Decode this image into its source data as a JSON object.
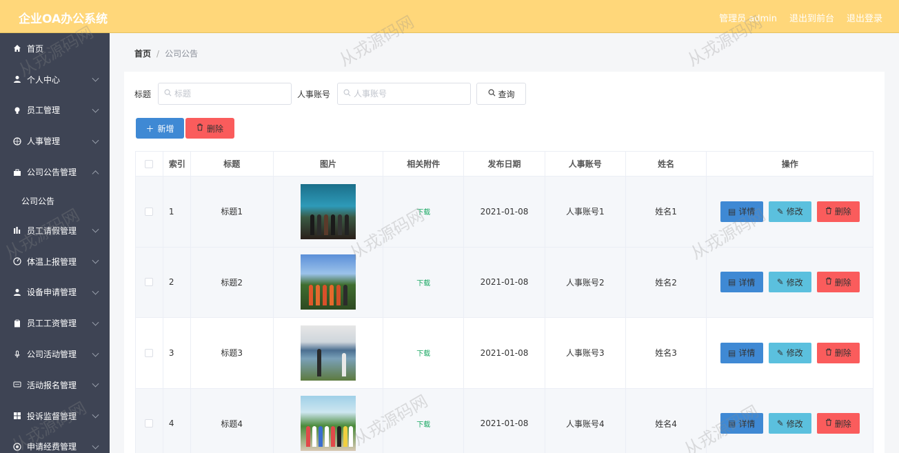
{
  "app": {
    "title": "企业OA办公系统"
  },
  "top_nav": {
    "user": "管理员 admin",
    "frontend": "退出到前台",
    "logout": "退出登录"
  },
  "sidebar": {
    "items": [
      {
        "label": "首页",
        "icon": "home-icon"
      },
      {
        "label": "个人中心",
        "icon": "user-icon"
      },
      {
        "label": "员工管理",
        "icon": "bulb-icon"
      },
      {
        "label": "人事管理",
        "icon": "compass-icon"
      },
      {
        "label": "公司公告管理",
        "icon": "briefcase-icon"
      },
      {
        "label": "公司公告",
        "sub": true
      },
      {
        "label": "员工请假管理",
        "icon": "chart-icon"
      },
      {
        "label": "体温上报管理",
        "icon": "gauge-icon"
      },
      {
        "label": "设备申请管理",
        "icon": "user-icon"
      },
      {
        "label": "员工工资管理",
        "icon": "clipboard-icon"
      },
      {
        "label": "公司活动管理",
        "icon": "mic-icon"
      },
      {
        "label": "活动报名管理",
        "icon": "chat-icon"
      },
      {
        "label": "投诉监督管理",
        "icon": "grid-icon"
      },
      {
        "label": "申请经费管理",
        "icon": "coin-icon"
      }
    ]
  },
  "breadcrumb": {
    "home": "首页",
    "separator": "/",
    "current": "公司公告"
  },
  "search": {
    "title_label": "标题",
    "title_placeholder": "标题",
    "title_value": "",
    "account_label": "人事账号",
    "account_placeholder": "人事账号",
    "account_value": "",
    "query_button": "查询"
  },
  "actions": {
    "add": "新增",
    "delete": "删除"
  },
  "table": {
    "columns": [
      "",
      "索引",
      "标题",
      "图片",
      "相关附件",
      "发布日期",
      "人事账号",
      "姓名",
      "操作"
    ],
    "rows": [
      {
        "index": "1",
        "title": "标题1",
        "attachment": "下载",
        "date": "2021-01-08",
        "account": "人事账号1",
        "name": "姓名1"
      },
      {
        "index": "2",
        "title": "标题2",
        "attachment": "下载",
        "date": "2021-01-08",
        "account": "人事账号2",
        "name": "姓名2"
      },
      {
        "index": "3",
        "title": "标题3",
        "attachment": "下载",
        "date": "2021-01-08",
        "account": "人事账号3",
        "name": "姓名3"
      },
      {
        "index": "4",
        "title": "标题4",
        "attachment": "下载",
        "date": "2021-01-08",
        "account": "人事账号4",
        "name": "姓名4"
      }
    ],
    "row_actions": {
      "detail": "详情",
      "edit": "修改",
      "delete": "删除"
    }
  },
  "watermark": "从戎源码网",
  "colors": {
    "topbar": "#ffd77a",
    "sidebar": "#3e4454",
    "primary": "#3f89d4",
    "info": "#5bc0de",
    "danger": "#fa5c5c",
    "link": "#19a862"
  }
}
